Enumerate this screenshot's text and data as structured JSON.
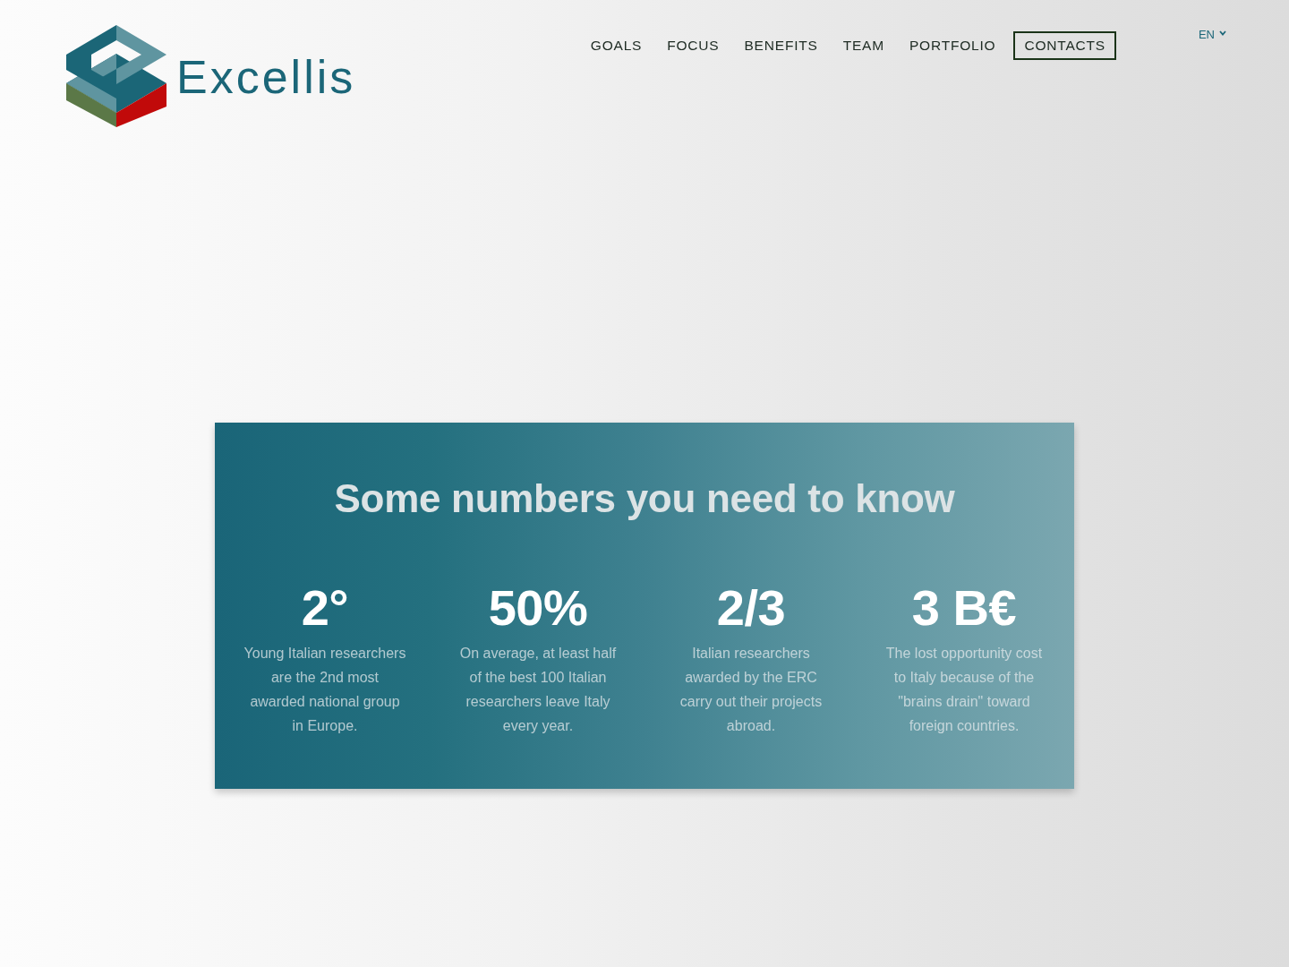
{
  "header": {
    "brand": "Excellis",
    "nav": [
      {
        "label": "GOALS",
        "selected": false
      },
      {
        "label": "FOCUS",
        "selected": false
      },
      {
        "label": "BENEFITS",
        "selected": false
      },
      {
        "label": "TEAM",
        "selected": false
      },
      {
        "label": "PORTFOLIO",
        "selected": false
      },
      {
        "label": "CONTACTS",
        "selected": true
      }
    ],
    "language": "EN"
  },
  "stats_panel": {
    "title": "Some numbers you need to know",
    "stats": [
      {
        "value": "2°",
        "description": "Young Italian researchers are the 2nd most awarded national group in Europe."
      },
      {
        "value": "50%",
        "description": "On average, at least half of the best 100 Italian researchers leave Italy  every year."
      },
      {
        "value": "2/3",
        "description": "Italian researchers awarded by the ERC carry out their projects abroad."
      },
      {
        "value": "3 B€",
        "description": "The lost opportunity cost to Italy because of the  \"brains drain\" toward foreign countries."
      }
    ]
  }
}
